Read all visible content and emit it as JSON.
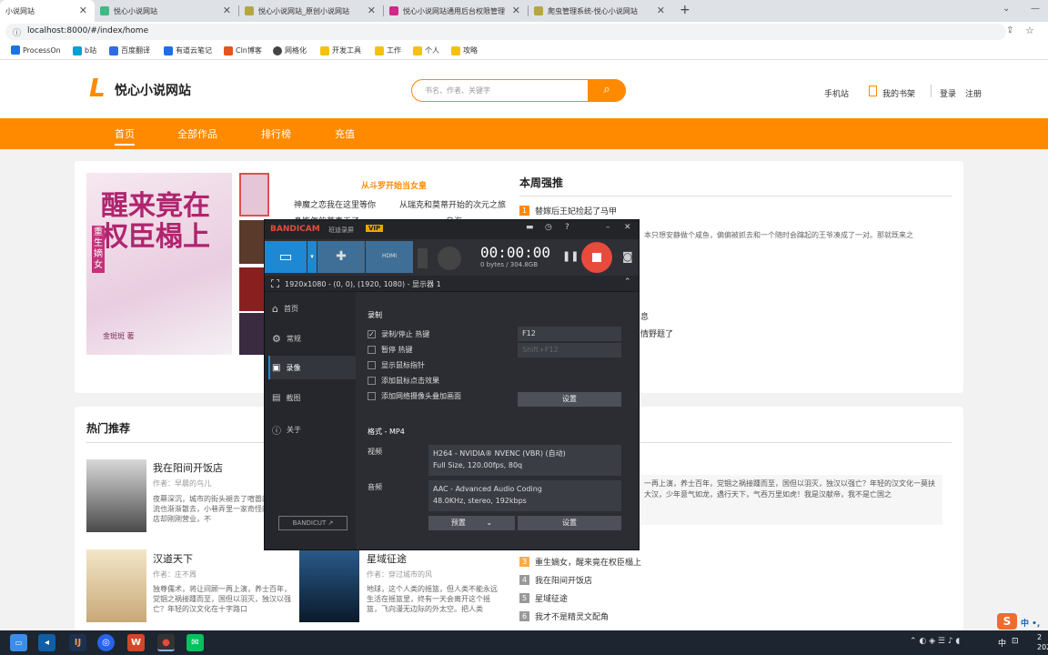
{
  "browser": {
    "tabs": [
      {
        "title": "小说网站",
        "active": true
      },
      {
        "title": "悦心小说网站"
      },
      {
        "title": "悦心小说网站_原创小说网站"
      },
      {
        "title": "悦心小说网站通用后台权限管理"
      },
      {
        "title": "爬虫管理系统-悦心小说网站"
      }
    ],
    "new_tab": "+",
    "url": "localhost:8000/#/index/home",
    "bookmarks": [
      "ProcessOn",
      "b站",
      "百度翻译",
      "有道云笔记",
      "Cln博客",
      "网格化",
      "开发工具",
      "工作",
      "个人",
      "攻略"
    ]
  },
  "site": {
    "logo_mark": "L",
    "logo_text": "悦心小说网站",
    "search_placeholder": "书名、作者、关键字",
    "header_links": [
      "手机站",
      "我的书架",
      "登录",
      "注册"
    ],
    "nav": [
      "首页",
      "全部作品",
      "排行榜",
      "充值"
    ],
    "banner": {
      "cover_title": "醒来竟在权臣榻上",
      "cover_sub": "重生嫡女",
      "cover_author": "金斑斑 著",
      "featured_title": "从斗罗开始当女皇",
      "featured_links": [
        "神魔之恋我在这里等你",
        "从瑞克和莫蒂开始的次元之旅",
        "身饰怎的莫直无了",
        "乌海"
      ]
    },
    "weekly": {
      "title": "本周强推",
      "items": [
        "替嫁后王妃捡起了马甲"
      ],
      "desc": "，本只想安静做个咸鱼，偏偏被抓去和一个随时会蹿起的王爷凑成了一对。那就既来之",
      "snippet_a": "息",
      "snippet_b": "情野题了"
    },
    "hot": {
      "title": "热门推荐",
      "books": [
        {
          "title": "我在阳间开饭店",
          "author": "作者：早晨的鸟儿",
          "desc": "夜幕深沉，城市的街头褪去了喧嚣的人流也渐渐散去，小巷弄里一家奇怪的饭店却刚刚营业，不"
        },
        {
          "title": "汉道天下",
          "author": "作者：庄不周",
          "desc": "独尊儒术，将让间顾一再上演，养士百年，党锢之祸接踵而至，国但以羽灭，独汉以强亡？年轻的汉文化在十字路口"
        },
        {
          "title": "星域征途",
          "author": "作者：穿过城市的风",
          "desc": "地球，这个人类的摇篮，但人类不能永远生活在摇篮里，终有一天会离开这个摇篮，飞向漫无边际的外太空。把人类"
        }
      ],
      "right_desc": "一再上演，养士百年，党锢之祸接踵而至，国但以羽灭，独汉以强亡？年轻的汉文化一莫扶大汉，少年意气如龙，遇行天下，气吞万里如虎！我是汉献帝，我不是亡国之",
      "ranks": [
        {
          "n": "3",
          "t": "重生嫡女，醒来竟在权臣榻上"
        },
        {
          "n": "4",
          "t": "我在阳间开饭店"
        },
        {
          "n": "5",
          "t": "星域征途"
        },
        {
          "n": "6",
          "t": "我才不是精灵文配角"
        }
      ]
    }
  },
  "bandicam": {
    "brand": "BANDICAM",
    "brand_cn": "班迪录屏",
    "vip": "VIP",
    "timer": "00:00:00",
    "size": "0 bytes / 304.8GB",
    "hdmi": "HDMI",
    "region": "1920x1080 - (0, 0), (1920, 1080) - 显示器 1",
    "sidebar": [
      "首页",
      "常规",
      "录像",
      "截图",
      "关于"
    ],
    "section_record": "录制",
    "options": [
      "录制/停止 热键",
      "暂停 热键",
      "显示鼠标指针",
      "添加鼠标点击效果",
      "添加网络摄像头叠加画面"
    ],
    "hotkey_record": "F12",
    "hotkey_pause": "Shift+F12",
    "settings_btn": "设置",
    "format_label": "格式 - MP4",
    "video_label": "视频",
    "video_line1": "H264 - NVIDIA® NVENC (VBR) (自动)",
    "video_line2": "Full Size, 120.00fps, 80q",
    "audio_label": "音频",
    "audio_line1": "AAC - Advanced Audio Coding",
    "audio_line2": "48.0KHz, stereo, 192kbps",
    "preset_btn": "预置",
    "settings_btn2": "设置",
    "bandicut": "BANDICUT ↗"
  },
  "taskbar": {
    "ime": "中",
    "time": "2",
    "date": "202"
  },
  "colors": {
    "accent": "#ff8a00",
    "bandicam_blue": "#1e88d2",
    "record_red": "#e84b3c"
  }
}
